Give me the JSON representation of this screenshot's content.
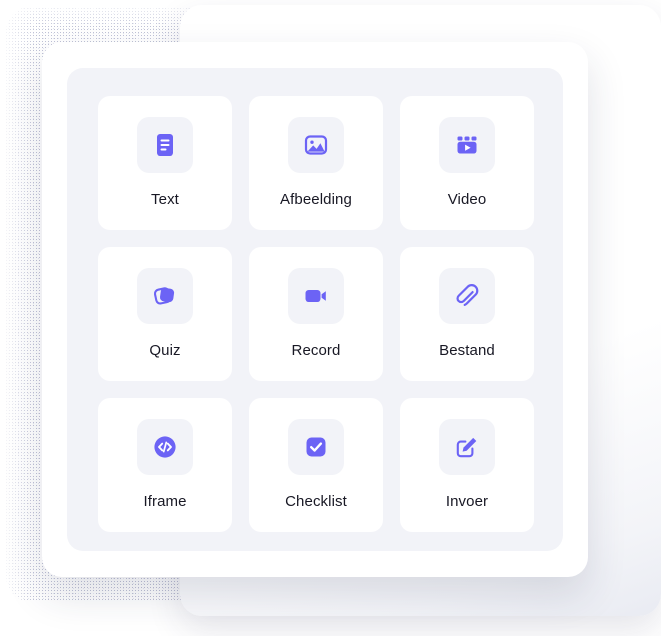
{
  "theme": {
    "accent": "#6C63F5",
    "panel_bg": "#F2F3F8",
    "tile_bg": "#FFFFFF",
    "card_bg": "#FFFFFF",
    "label_color": "#181824",
    "backdrop": "#22253F"
  },
  "picker": {
    "tiles": [
      {
        "id": "text",
        "label": "Text",
        "icon": "text-document-icon"
      },
      {
        "id": "image",
        "label": "Afbeelding",
        "icon": "image-icon"
      },
      {
        "id": "video",
        "label": "Video",
        "icon": "video-player-icon"
      },
      {
        "id": "quiz",
        "label": "Quiz",
        "icon": "layered-cards-icon"
      },
      {
        "id": "record",
        "label": "Record",
        "icon": "video-camera-icon"
      },
      {
        "id": "file",
        "label": "Bestand",
        "icon": "paperclip-icon"
      },
      {
        "id": "iframe",
        "label": "Iframe",
        "icon": "code-circle-icon"
      },
      {
        "id": "checklist",
        "label": "Checklist",
        "icon": "checkmark-square-icon"
      },
      {
        "id": "input",
        "label": "Invoer",
        "icon": "edit-pencil-square-icon"
      }
    ]
  }
}
